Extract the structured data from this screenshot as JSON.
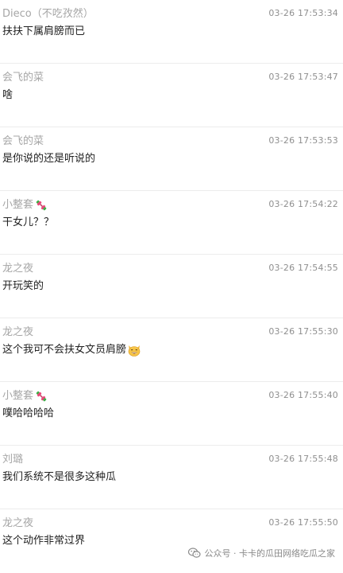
{
  "comments": [
    {
      "author": "Dieco（不吃孜然）",
      "author_icon": null,
      "time": "03-26 17:53:34",
      "text": "扶扶下属肩膀而已",
      "text_icon": null
    },
    {
      "author": "会飞的菜",
      "author_icon": null,
      "time": "03-26 17:53:47",
      "text": "啥",
      "text_icon": null
    },
    {
      "author": "会飞的菜",
      "author_icon": null,
      "time": "03-26 17:53:53",
      "text": "是你说的还是听说的",
      "text_icon": null
    },
    {
      "author": "小整套",
      "author_icon": "dumbbell-icon",
      "time": "03-26 17:54:22",
      "text": "干女儿？？",
      "text_icon": null
    },
    {
      "author": "龙之夜",
      "author_icon": null,
      "time": "03-26 17:54:55",
      "text": "开玩笑的",
      "text_icon": null
    },
    {
      "author": "龙之夜",
      "author_icon": null,
      "time": "03-26 17:55:30",
      "text": "这个我可不会扶女文员肩膀",
      "text_icon": "grinning-cat-icon"
    },
    {
      "author": "小整套",
      "author_icon": "dumbbell-icon",
      "time": "03-26 17:55:40",
      "text": "噗哈哈哈哈",
      "text_icon": null
    },
    {
      "author": "刘璐",
      "author_icon": null,
      "time": "03-26 17:55:48",
      "text": "我们系统不是很多这种瓜",
      "text_icon": null
    },
    {
      "author": "龙之夜",
      "author_icon": null,
      "time": "03-26 17:55:50",
      "text": "这个动作非常过界",
      "text_icon": null
    }
  ],
  "watermark": {
    "icon": "wechat-official-account-icon",
    "text": "公众号 · 卡卡的瓜田网络吃瓜之家"
  },
  "colors": {
    "author": "#a6a6a6",
    "time": "#8f8f8f",
    "text": "#222222",
    "separator": "#ececec"
  }
}
